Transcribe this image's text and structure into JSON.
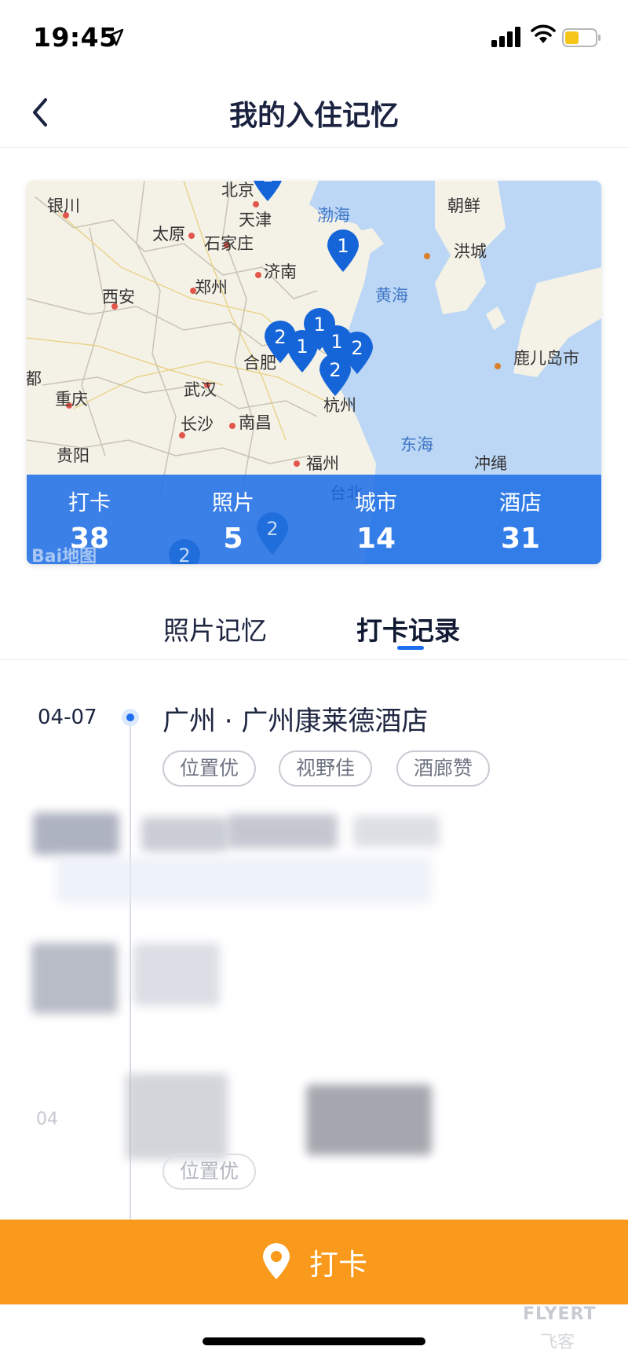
{
  "status_bar": {
    "time": "19:45",
    "icons": [
      "location-arrow-icon",
      "signal-icon",
      "wifi-icon",
      "battery-icon"
    ]
  },
  "header": {
    "title": "我的入住记忆",
    "back_icon": "chevron-left-icon"
  },
  "map": {
    "labels": {
      "beijing": "北京",
      "tianjin": "天津",
      "bohai": "渤海",
      "yinchuan": "银川",
      "taiyuan": "太原",
      "shijiazhuang": "石家庄",
      "jinan": "济南",
      "chaoxian": "朝鲜",
      "hongcheng": "洪城",
      "xian": "西安",
      "zhengzhou": "郑州",
      "huanghai": "黄海",
      "hefei": "合肥",
      "wuhan": "武汉",
      "chongqing": "重庆",
      "chengdu": "都",
      "nanchang": "南昌",
      "hangzhou": "杭州",
      "changsha": "长沙",
      "lujiandao": "鹿儿岛市",
      "donghai": "东海",
      "guiyang": "贵阳",
      "fuzhou": "福州",
      "chongsheng": "冲绳",
      "taibei": "台北"
    },
    "pins": [
      "1",
      "1",
      "2",
      "1",
      "1",
      "1",
      "2",
      "2",
      "2",
      "2"
    ],
    "logo": "Bai地图",
    "colors": {
      "sea": "#bcd7f5",
      "land": "#f4f1e6",
      "pin": "#1565d8"
    }
  },
  "stats": [
    {
      "label": "打卡",
      "value": "38"
    },
    {
      "label": "照片",
      "value": "5"
    },
    {
      "label": "城市",
      "value": "14"
    },
    {
      "label": "酒店",
      "value": "31"
    }
  ],
  "tabs": [
    {
      "label": "照片记忆",
      "active": false
    },
    {
      "label": "打卡记录",
      "active": true
    }
  ],
  "entries": [
    {
      "date": "04-07",
      "title": "广州 · 广州康莱德酒店",
      "tags": [
        "位置优",
        "视野佳",
        "酒廊赞"
      ]
    }
  ],
  "faded_entry": {
    "date": "04",
    "tag": "位置优"
  },
  "checkin_button": {
    "label": "打卡",
    "icon": "map-pin-icon",
    "color": "#f99a1c"
  },
  "watermark": {
    "text": "FLYERT",
    "sub": "飞客"
  }
}
